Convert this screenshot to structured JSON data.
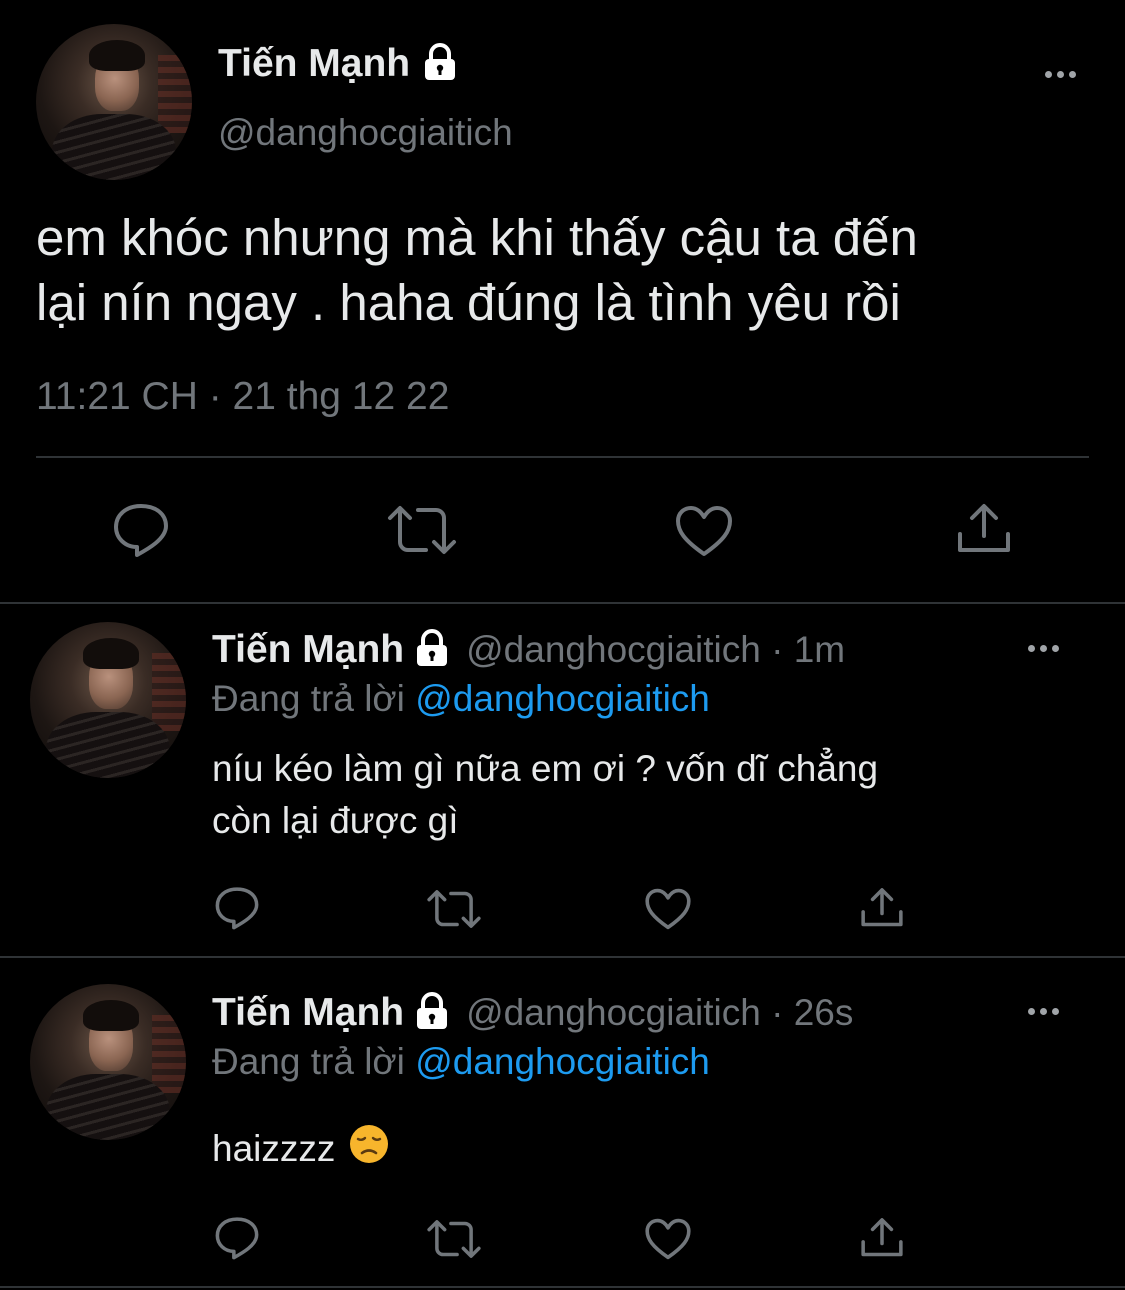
{
  "main_tweet": {
    "display_name": "Tiến Mạnh",
    "handle": "@danghocgiaitich",
    "text_line1": "em khóc nhưng mà khi thấy cậu ta đến",
    "text_line2": "lại nín ngay . haha đúng là tình yêu rồi",
    "timestamp": "11:21 CH · 21 thg 12 22"
  },
  "replies": [
    {
      "display_name": "Tiến Mạnh",
      "handle_time": "@danghocgiaitich · 1m",
      "replying_label": "Đang trả lời",
      "replying_to": "@danghocgiaitich",
      "text_line1": "níu kéo làm gì nữa em ơi ? vốn dĩ chẳng",
      "text_line2": "còn lại được gì"
    },
    {
      "display_name": "Tiến Mạnh",
      "handle_time": "@danghocgiaitich · 26s",
      "replying_label": "Đang trả lời",
      "replying_to": "@danghocgiaitich",
      "text_line1": "haizzzz",
      "emoji": "😞"
    }
  ],
  "icons": {
    "lock": "lock-icon",
    "more": "more-icon",
    "reply": "reply-icon",
    "retweet": "retweet-icon",
    "like": "like-icon",
    "share": "share-icon"
  },
  "colors": {
    "background": "#000000",
    "text": "#e7e9ea",
    "muted": "#71767b",
    "link": "#1d9bf0",
    "divider": "#2f3336"
  }
}
